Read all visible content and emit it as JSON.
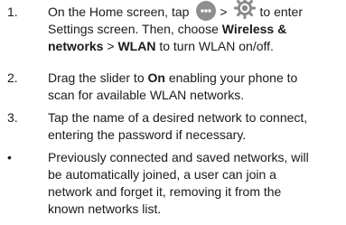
{
  "steps": [
    {
      "marker": "1.",
      "line1_before": "On the Home screen, tap",
      "line1_sep": ">",
      "line1_after": "to enter",
      "line2": "Settings screen. Then, choose",
      "line2_bold": "Wireless &",
      "line3_bold_a": "networks",
      "line3_sep": ">",
      "line3_bold_b": "WLAN",
      "line3_after": "to turn WLAN on/off."
    },
    {
      "marker": "2.",
      "line1_before": "Drag the slider to",
      "line1_bold": "On",
      "line1_after": "enabling your phone to",
      "line2": "scan for available WLAN networks."
    },
    {
      "marker": "3.",
      "line1": "Tap the name of a desired network to connect,",
      "line2": "entering the password if necessary."
    },
    {
      "marker": "•",
      "lines": [
        "Previously connected and saved networks, will",
        "be automatically joined, a user can join a",
        "network and forget it, removing it from the",
        "known networks list."
      ]
    }
  ],
  "icons": {
    "apps": "apps-launcher-icon",
    "settings": "gear-icon",
    "apps_color": "#8e8e8e",
    "gear_color": "#8a8a8a"
  }
}
